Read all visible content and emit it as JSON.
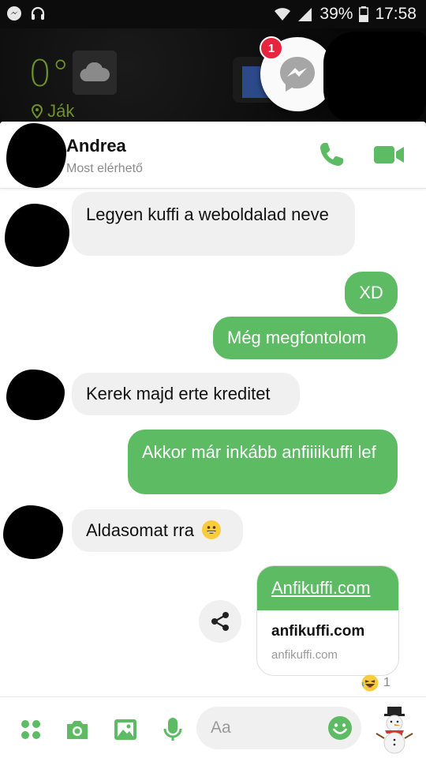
{
  "status_bar": {
    "battery": "39%",
    "time": "17:58"
  },
  "home_screen": {
    "temperature": "0°",
    "city": "Ják"
  },
  "chat_head": {
    "badge_count": "1"
  },
  "header": {
    "name": "Andrea",
    "status": "Most elérhető"
  },
  "messages": [
    {
      "from": "them",
      "text": "Legyen kuffi a weboldalad neve"
    },
    {
      "from": "me",
      "text": "XD"
    },
    {
      "from": "me",
      "text": "Még megfontolom"
    },
    {
      "from": "them",
      "text": "Kerek majd erte kreditet"
    },
    {
      "from": "me",
      "text": "Akkor már inkább anfiiiikuffi lef"
    },
    {
      "from": "them",
      "text": "Aldasomat rra"
    }
  ],
  "link_preview": {
    "link_text": "Anfikuffi.com",
    "title": "anfikuffi.com",
    "domain": "anfikuffi.com"
  },
  "reaction": {
    "emoji": "laughing-face",
    "count": "1"
  },
  "composer": {
    "placeholder": "Aa"
  },
  "colors": {
    "accent": "#5dbb64",
    "incoming_bubble": "#f1f0f0",
    "badge": "#e8253f"
  }
}
